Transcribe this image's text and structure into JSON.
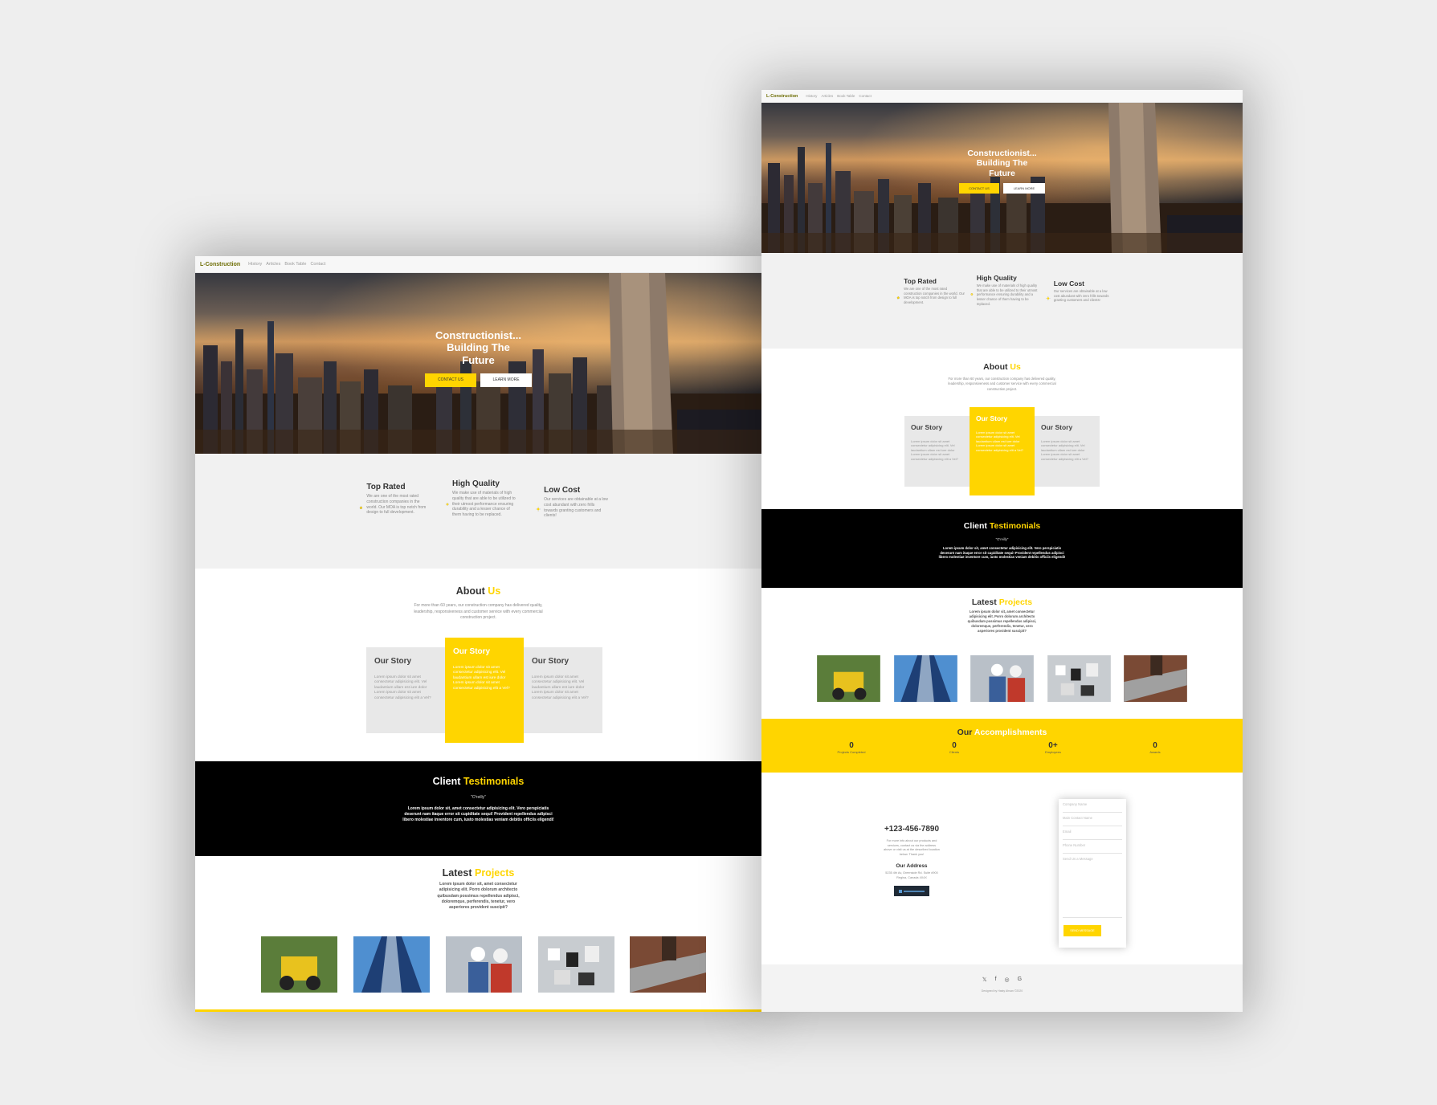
{
  "nav": {
    "brand": "L-Construction",
    "links": [
      "History",
      "Articles",
      "Book Table",
      "Contact"
    ]
  },
  "hero": {
    "title_line1": "Constructionist...",
    "title_line2": "Building The",
    "title_line3": "Future",
    "contact_button": "CONTACT US",
    "learn_button": "LEARN MORE"
  },
  "features": [
    {
      "title": "Top Rated",
      "text": "We are one of the most rated construction companies in the world. Our MOA is top notch from design to full development.",
      "icon": "hand-icon"
    },
    {
      "title": "High Quality",
      "text": "We make use of materials of high quality that are able to be utilized to their utmost performance ensuring durability and a lesser chance of them having to be replaced.",
      "icon": "gear-icon"
    },
    {
      "title": "Low Cost",
      "text": "Our services are obtainable at a low cost abundant with zero frills towards granting customers and clients!",
      "icon": "coin-icon"
    }
  ],
  "about": {
    "title_plain": "About",
    "title_accent": "Us",
    "intro": "For more than 60 years, our construction company has delivered quality, leadership, responsiveness and customer service with every commercial construction project.",
    "cards": [
      {
        "title": "Our Story",
        "text": "Lorem ipsum dolor sit amet consectetur adipisicing elit. Vel laudantium ullam est iure dolor Lorem ipsum dolor sit amet consectetur adipisicing elit a Vel?"
      },
      {
        "title": "Our Story",
        "text": "Lorem ipsum dolor sit amet consectetur adipisicing elit. Vel laudantium ullam est iure dolor Lorem ipsum dolor sit amet consectetur adipisicing elit a Vel?"
      },
      {
        "title": "Our Story",
        "text": "Lorem ipsum dolor sit amet consectetur adipisicing elit. Vel laudantium ullam est iure dolor Lorem ipsum dolor sit amet consectetur adipisicing elit a Vel?"
      }
    ]
  },
  "testimonials": {
    "title_plain": "Client",
    "title_accent": "Testimonials",
    "name": "\"O'reilly\"",
    "text": "Lorem ipsum dolor sit, amet consectetur adipisicing elit. Vero perspiciatis deserunt nam itaque error sit cupiditate sequi! Provident repellendus adipisci libero molestiae inventore cum, iusto molestias veniam debitis officiis eligendi!"
  },
  "projects": {
    "title_plain": "Latest",
    "title_accent": "Projects",
    "text": "Lorem ipsum dolor sit, amet consectetur adipisicing elit. Porro dolorum architecto quibusdam possimus repellendus adipisci, doloremque, perferendis, tenetur, vero asperiores provident suscipit?"
  },
  "accomplishments": {
    "title_plain": "Our",
    "title_accent": "Accomplishments",
    "stats": [
      {
        "value": "0",
        "label": "Projects Completed"
      },
      {
        "value": "0",
        "label": "Clients"
      },
      {
        "value": "0+",
        "label": "Employees"
      },
      {
        "value": "0",
        "label": "Awards"
      }
    ]
  },
  "contact": {
    "phone": "+123-456-7890",
    "intro": "For more info about our products and services, contact us via the address above or visit us at the described location below. Thank you!",
    "address_title": "Our Address",
    "address": "5235 4th Av, Greenside Rd. Suite #900 Regina, Canada 4X4X",
    "form": {
      "company": "Company Name",
      "main_contact": "Main Contact Name",
      "email": "Email",
      "phone": "Phone Number",
      "message": "Send Us a Message",
      "submit": "SEND MESSAGE"
    }
  },
  "footer": {
    "credit": "Designed by Hasty Ahsan ©2020",
    "social": [
      "twitter-icon",
      "facebook-icon",
      "instagram-icon",
      "google-icon"
    ]
  },
  "colors": {
    "accent": "#ffd500",
    "dark": "#000000",
    "light_bg": "#f1f1f1"
  }
}
